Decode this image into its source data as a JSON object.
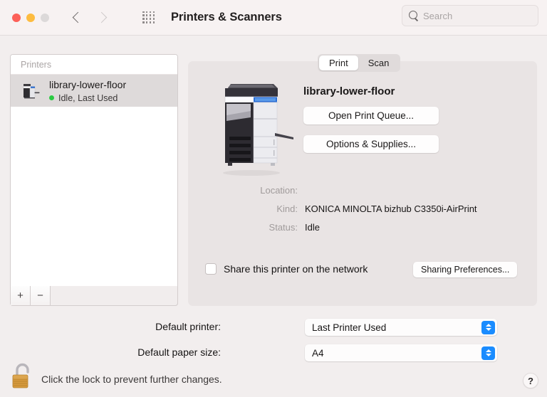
{
  "window": {
    "title": "Printers & Scanners",
    "traffic_lights": [
      "close",
      "minimize",
      "zoom"
    ],
    "nav_back_icon": "chevron-left-icon",
    "nav_forward_icon": "chevron-right-icon",
    "grid_icon": "grid-apps-icon"
  },
  "search": {
    "placeholder": "Search",
    "value": "",
    "icon": "search-icon"
  },
  "printer_list": {
    "header": "Printers",
    "items": [
      {
        "name": "library-lower-floor",
        "status": "Idle, Last Used",
        "status_color": "#2bca42",
        "selected": true,
        "icon": "printer-icon"
      }
    ],
    "add_label": "+",
    "remove_label": "−"
  },
  "tabs": [
    {
      "label": "Print",
      "selected": true
    },
    {
      "label": "Scan",
      "selected": false
    }
  ],
  "detail": {
    "device_name": "library-lower-floor",
    "printer_image": "multifunction-printer-illustration",
    "open_queue_label": "Open Print Queue...",
    "options_supplies_label": "Options & Supplies...",
    "fields": [
      {
        "key": "Location:",
        "value": ""
      },
      {
        "key": "Kind:",
        "value": "KONICA MINOLTA bizhub C3350i-AirPrint"
      },
      {
        "key": "Status:",
        "value": "Idle"
      }
    ],
    "share": {
      "label": "Share this printer on the network",
      "checked": false,
      "button_label": "Sharing Preferences..."
    }
  },
  "defaults": {
    "printer_label": "Default printer:",
    "printer_value": "Last Printer Used",
    "paper_label": "Default paper size:",
    "paper_value": "A4",
    "stepper_color": "#1a8cff"
  },
  "footer": {
    "lock_icon": "unlocked-padlock-icon",
    "lock_text": "Click the lock to prevent further changes.",
    "help_label": "?"
  }
}
